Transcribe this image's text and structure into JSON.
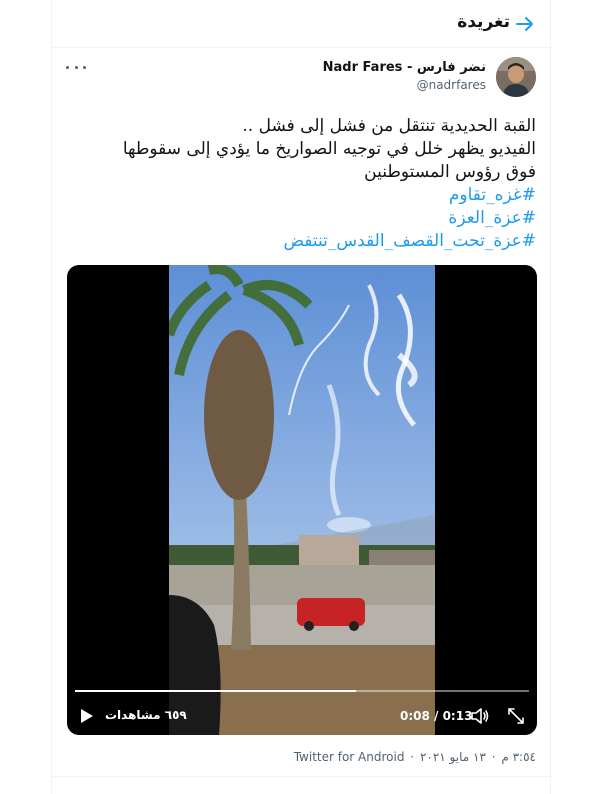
{
  "header": {
    "title": "تغريدة"
  },
  "author": {
    "name": "نضر فارس - Nadr Fares",
    "handle": "@nadrfares"
  },
  "tweet": {
    "lines": [
      "القبة الحديدية تنتقل من فشل إلى فشل ..",
      "الفيديو يظهر خلل في توجيه الصواريخ ما يؤدي إلى سقوطها",
      "فوق رؤوس المستوطنين"
    ],
    "hashtags": [
      "#غزه_تقاوم",
      "#عزة_العزة",
      "#عزة_تحت_القصف_القدس_تنتفض"
    ]
  },
  "video": {
    "views": "٦٥٩ مشاهدات",
    "time": "0:08 / 0:13",
    "progress": 0.62
  },
  "meta": {
    "time": "٣:٥٤ م",
    "date": "١٣ مايو ٢٠٢١",
    "source": "Twitter for Android"
  },
  "colors": {
    "link": "#1d9bf0",
    "muted": "#536471",
    "text": "#0f1419"
  },
  "icons": [
    "back-arrow-icon",
    "more-icon",
    "play-icon",
    "volume-icon",
    "fullscreen-icon"
  ]
}
